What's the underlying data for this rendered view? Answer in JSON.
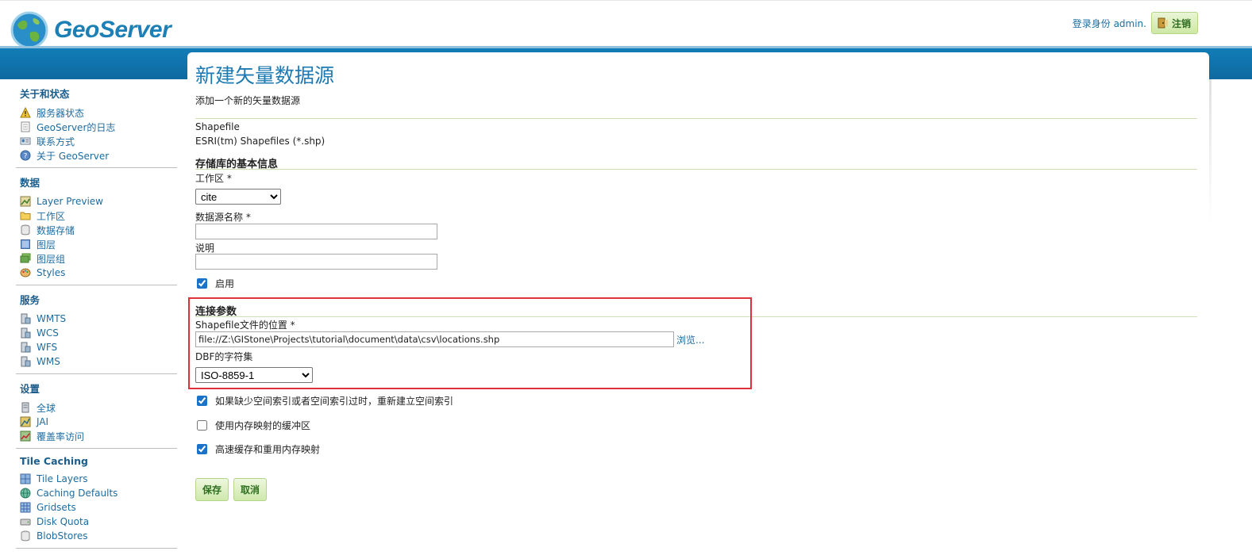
{
  "header": {
    "brand": "GeoServer",
    "user_text": "登录身份 admin.",
    "logout_label": "注销"
  },
  "sidebar": {
    "sections": [
      {
        "title": "关于和状态",
        "items": [
          {
            "label": "服务器状态",
            "icon": "warning-icon"
          },
          {
            "label": "GeoServer的日志",
            "icon": "document-icon"
          },
          {
            "label": "联系方式",
            "icon": "contact-card-icon"
          },
          {
            "label": "关于 GeoServer",
            "icon": "help-icon"
          }
        ]
      },
      {
        "title": "数据",
        "items": [
          {
            "label": "Layer Preview",
            "icon": "map-preview-icon"
          },
          {
            "label": "工作区",
            "icon": "folder-icon"
          },
          {
            "label": "数据存储",
            "icon": "database-icon"
          },
          {
            "label": "图层",
            "icon": "layer-icon"
          },
          {
            "label": "图层组",
            "icon": "layer-group-icon"
          },
          {
            "label": "Styles",
            "icon": "palette-icon"
          }
        ]
      },
      {
        "title": "服务",
        "items": [
          {
            "label": "WMTS",
            "icon": "server-icon"
          },
          {
            "label": "WCS",
            "icon": "server-icon"
          },
          {
            "label": "WFS",
            "icon": "server-icon"
          },
          {
            "label": "WMS",
            "icon": "server-icon"
          }
        ]
      },
      {
        "title": "设置",
        "items": [
          {
            "label": "全球",
            "icon": "settings-server-icon"
          },
          {
            "label": "JAI",
            "icon": "jai-icon"
          },
          {
            "label": "覆盖率访问",
            "icon": "coverage-icon"
          }
        ]
      },
      {
        "title": "Tile Caching",
        "items": [
          {
            "label": "Tile Layers",
            "icon": "tile-grid-icon"
          },
          {
            "label": "Caching Defaults",
            "icon": "globe-icon"
          },
          {
            "label": "Gridsets",
            "icon": "grid-icon"
          },
          {
            "label": "Disk Quota",
            "icon": "disk-icon"
          },
          {
            "label": "BlobStores",
            "icon": "database-icon"
          }
        ]
      }
    ]
  },
  "main": {
    "title": "新建矢量数据源",
    "description": "添加一个新的矢量数据源",
    "store_type": "Shapefile",
    "store_type_desc": "ESRI(tm) Shapefiles (*.shp)",
    "basic_section": "存储库的基本信息",
    "workspace_label": "工作区 *",
    "workspace_value": "cite",
    "name_label": "数据源名称 *",
    "name_value": "",
    "desc_label": "说明",
    "desc_value": "",
    "enabled_label": "启用",
    "enabled": true,
    "conn_section": "连接参数",
    "url_label": "Shapefile文件的位置 *",
    "url_value": "file://Z:\\GIStone\\Projects\\tutorial\\document\\data\\csv\\locations.shp",
    "browse_label": "浏览...",
    "charset_label": "DBF的字符集",
    "charset_value": "ISO-8859-1",
    "opt_spatial_index": "如果缺少空间索引或者空间索引过时，重新建立空间索引",
    "opt_spatial_index_checked": true,
    "opt_memory_mapped": "使用内存映射的缓冲区",
    "opt_memory_mapped_checked": false,
    "opt_cache_reuse": "高速缓存和重用内存映射",
    "opt_cache_reuse_checked": true,
    "save_label": "保存",
    "cancel_label": "取消"
  },
  "colors": {
    "brand_blue": "#1c7fb6",
    "band_blue": "#127eb9",
    "highlight_red": "#e0303a",
    "button_green": "#cfe8ab"
  }
}
